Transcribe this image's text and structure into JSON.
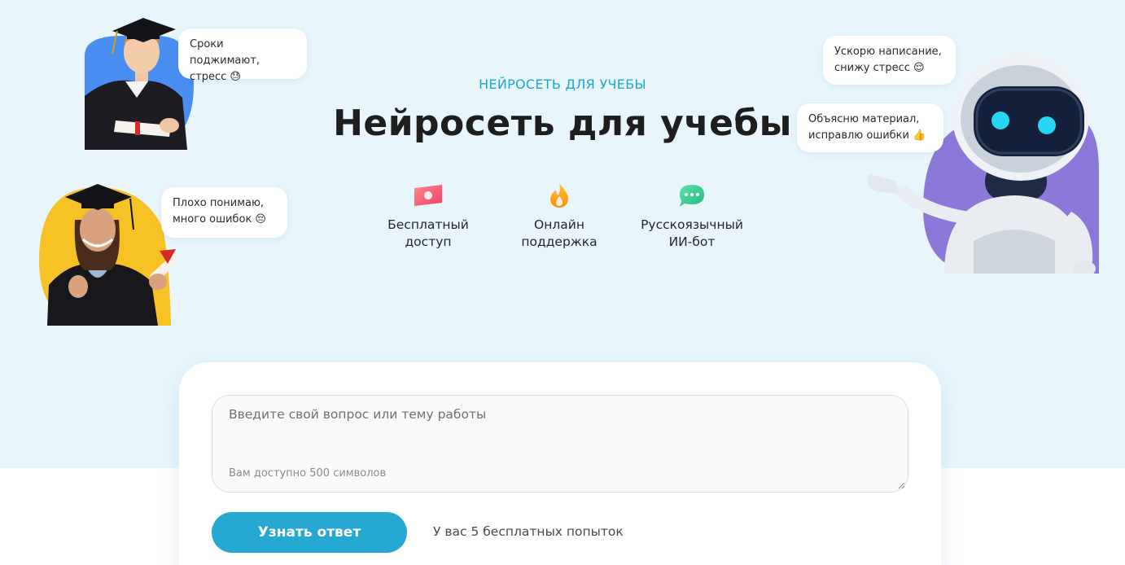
{
  "hero": {
    "eyebrow": "НЕЙРОСЕТЬ ДЛЯ УЧЕБЫ",
    "title": "Нейросеть для учебы"
  },
  "features": [
    {
      "icon": "banknote-icon",
      "label": "Бесплатный\nдоступ"
    },
    {
      "icon": "flame-icon",
      "label": "Онлайн\nподдержка"
    },
    {
      "icon": "chat-bubble-icon",
      "label": "Русскоязычный\nИИ-бот"
    }
  ],
  "bubbles": {
    "student_male": "Сроки поджимают,\nстресс 😓",
    "student_female": "Плохо понимаю,\nмного ошибок 😔",
    "robot_top": "Ускорю написание,\nснижу стресс 😌",
    "robot_bottom": "Объясню материал,\nисправлю ошибки 👍"
  },
  "form": {
    "question_placeholder": "Введите свой вопрос или тему работы",
    "char_limit": "Вам доступно 500 символов",
    "submit_label": "Узнать ответ",
    "attempts_text": "У вас 5 бесплатных попыток"
  },
  "colors": {
    "hero_bg": "#e8f6fc",
    "accent": "#27a8d3",
    "eyebrow": "#1ba7cf",
    "blob_blue": "#4a8ef2",
    "blob_yellow": "#f6c225",
    "blob_purple": "#8c78d9"
  }
}
